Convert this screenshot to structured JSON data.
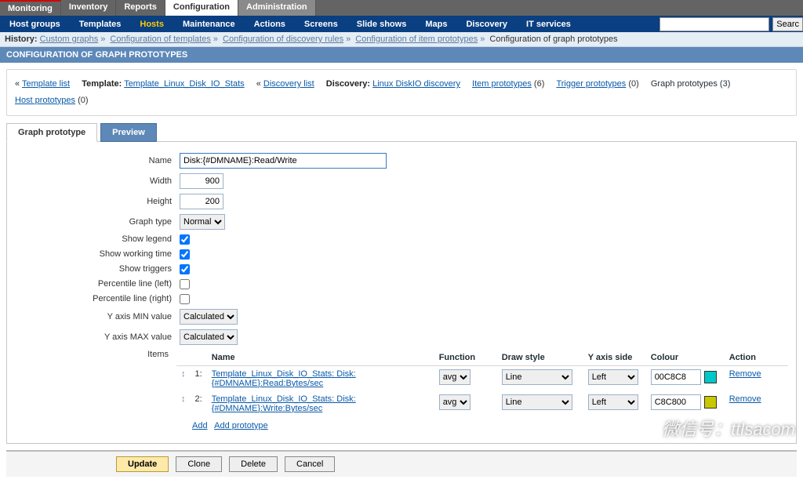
{
  "top_menu": [
    "Monitoring",
    "Inventory",
    "Reports",
    "Configuration",
    "Administration"
  ],
  "top_menu_active": 3,
  "sub_menu": [
    "Host groups",
    "Templates",
    "Hosts",
    "Maintenance",
    "Actions",
    "Screens",
    "Slide shows",
    "Maps",
    "Discovery",
    "IT services"
  ],
  "sub_menu_active": 2,
  "search_btn": "Searc",
  "history_label": "History:",
  "history_items": [
    "Custom graphs",
    "Configuration of templates",
    "Configuration of discovery rules",
    "Configuration of item prototypes",
    "Configuration of graph prototypes"
  ],
  "page_title": "CONFIGURATION OF GRAPH PROTOTYPES",
  "info": {
    "laquo": "«",
    "template_list": "Template list",
    "template_lbl": "Template:",
    "template_name": "Template_Linux_Disk_IO_Stats",
    "discovery_list": "Discovery list",
    "discovery_lbl": "Discovery:",
    "discovery_name": "Linux DiskIO discovery",
    "item_proto": "Item prototypes",
    "item_proto_cnt": "(6)",
    "trig_proto": "Trigger prototypes",
    "trig_proto_cnt": "(0)",
    "graph_proto": "Graph prototypes (3)",
    "host_proto": "Host prototypes",
    "host_proto_cnt": "(0)"
  },
  "tabs": {
    "graph": "Graph prototype",
    "preview": "Preview"
  },
  "form": {
    "name_lbl": "Name",
    "name_val": "Disk:{#DMNAME}:Read/Write",
    "width_lbl": "Width",
    "width_val": "900",
    "height_lbl": "Height",
    "height_val": "200",
    "gtype_lbl": "Graph type",
    "gtype_val": "Normal",
    "legend_lbl": "Show legend",
    "work_lbl": "Show working time",
    "trig_lbl": "Show triggers",
    "pleft_lbl": "Percentile line (left)",
    "pright_lbl": "Percentile line (right)",
    "ymin_lbl": "Y axis MIN value",
    "ymin_val": "Calculated",
    "ymax_lbl": "Y axis MAX value",
    "ymax_val": "Calculated",
    "items_lbl": "Items"
  },
  "items_header": {
    "name": "Name",
    "func": "Function",
    "draw": "Draw style",
    "side": "Y axis side",
    "colour": "Colour",
    "action": "Action"
  },
  "items": [
    {
      "idx": "1:",
      "name": "Template_Linux_Disk_IO_Stats: Disk:{#DMNAME}:Read:Bytes/sec",
      "func": "avg",
      "draw": "Line",
      "side": "Left",
      "colour": "00C8C8",
      "swatch": "#00C8C8",
      "action": "Remove"
    },
    {
      "idx": "2:",
      "name": "Template_Linux_Disk_IO_Stats: Disk:{#DMNAME}:Write:Bytes/sec",
      "func": "avg",
      "draw": "Line",
      "side": "Left",
      "colour": "C8C800",
      "swatch": "#C8C800",
      "action": "Remove"
    }
  ],
  "items_foot": {
    "add": "Add",
    "add_proto": "Add prototype"
  },
  "buttons": {
    "update": "Update",
    "clone": "Clone",
    "delete": "Delete",
    "cancel": "Cancel"
  },
  "watermark": "微信号：ttlsacom"
}
